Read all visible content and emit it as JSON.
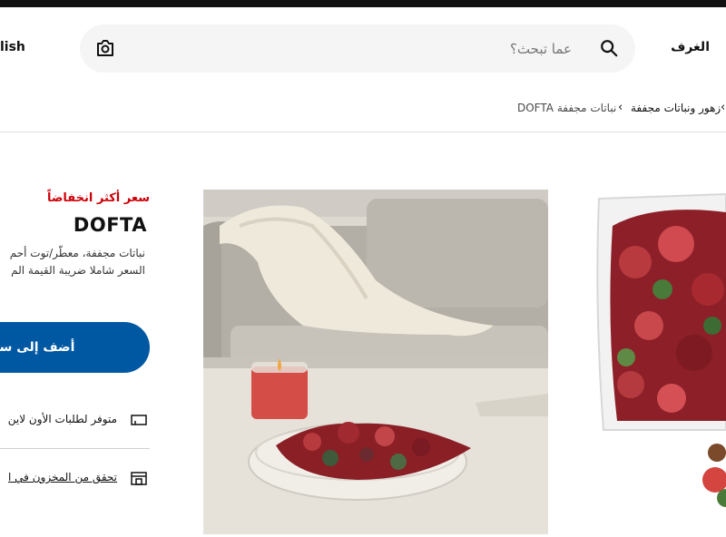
{
  "header": {
    "language_label": "lish",
    "search_placeholder": "عما تبحث؟",
    "rooms_label": "الغرف"
  },
  "breadcrumb": {
    "items": [
      "زهور ونباتات مجففة",
      "DOFTA نباتات مجففة"
    ]
  },
  "product": {
    "lowest_price_badge": "سعر أكثر انخفاضاً",
    "name": "DOFTA",
    "description": "نباتات مجففة، معطّر/توت أحم",
    "tax_note": "السعر شاملا ضريبة القيمة الم",
    "add_to_cart_label": "أضف إلى سلة التس",
    "online_availability": "متوفر لطلبات الأون لاين",
    "store_check_label": "تحقق من المخزون في ا"
  },
  "colors": {
    "accent_blue": "#0058a3",
    "sale_red": "#cc0008",
    "search_bg": "#f5f5f5"
  },
  "icons": {
    "camera": "camera-icon",
    "search": "search-icon",
    "truck": "truck-icon",
    "store": "store-icon"
  }
}
